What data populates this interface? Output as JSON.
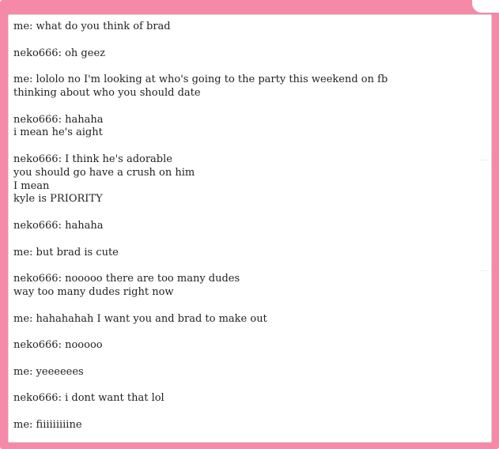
{
  "transcript": {
    "messages": [
      {
        "lines": [
          "me: what do you think of brad"
        ]
      },
      {
        "lines": [
          "neko666: oh geez"
        ]
      },
      {
        "lines": [
          "me: lololo no I'm looking at who's going to the party this weekend on fb",
          "thinking about who you should date"
        ]
      },
      {
        "lines": [
          "neko666: hahaha",
          "i mean he's aight"
        ]
      },
      {
        "lines": [
          "neko666: I think he's adorable",
          "you should go have a crush on him",
          "I mean",
          "kyle is PRIORITY"
        ]
      },
      {
        "lines": [
          "neko666: hahaha"
        ]
      },
      {
        "lines": [
          "me: but brad is cute"
        ]
      },
      {
        "lines": [
          "neko666: nooooo there are too many dudes",
          "way too many dudes right now"
        ]
      },
      {
        "lines": [
          "me: hahahahah I want you and brad to make out"
        ]
      },
      {
        "lines": [
          "neko666: nooooo"
        ]
      },
      {
        "lines": [
          "me: yeeeeees"
        ]
      },
      {
        "lines": [
          "neko666: i dont want that lol"
        ]
      },
      {
        "lines": [
          "me: fiiiiiiiiine"
        ]
      }
    ]
  },
  "colors": {
    "frame": "#f48aa8",
    "panel": "#ffffff",
    "text": "#222222"
  }
}
